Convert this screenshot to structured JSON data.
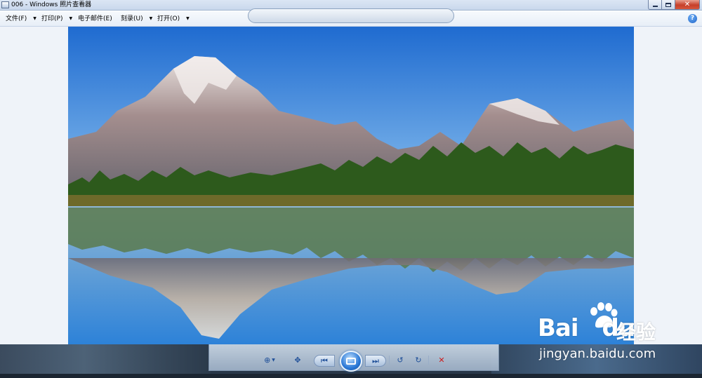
{
  "window": {
    "title": "006 - Windows 照片查看器",
    "close_glyph": "✕"
  },
  "menu": {
    "items": [
      {
        "label": "文件(F)"
      },
      {
        "label": "打印(P)"
      },
      {
        "label": "电子邮件(E)"
      },
      {
        "label": "刻录(U)"
      },
      {
        "label": "打开(O)"
      }
    ],
    "help_glyph": "?"
  },
  "controls": {
    "zoom_glyph": "⊕",
    "fit_glyph": "✥",
    "prev_glyph": "⏮",
    "next_glyph": "⏭",
    "rotate_ccw_glyph": "↺",
    "rotate_cw_glyph": "↻",
    "delete_glyph": "✕"
  },
  "watermark": {
    "brand": "Bai",
    "brand_suffix": "du",
    "product": "经验",
    "url": "jingyan.baidu.com"
  },
  "colors": {
    "sky_top": "#1f6bd0",
    "sky_bottom": "#8fc4f0",
    "delete_red": "#cc1c1c"
  }
}
